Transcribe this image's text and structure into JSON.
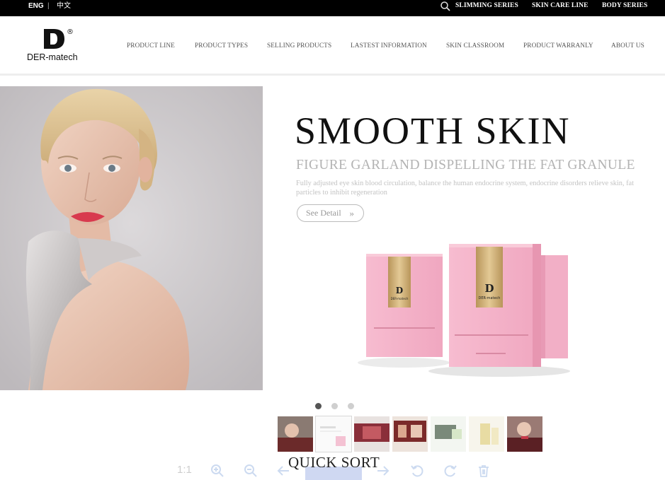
{
  "topbar": {
    "lang_eng": "ENG",
    "lang_separator": "|",
    "lang_cn": "中文",
    "search_icon": "search-icon",
    "series": [
      "SLIMMING SERIES",
      "SKIN CARE LINE",
      "BODY SERIES"
    ]
  },
  "header": {
    "logo_letter": "D",
    "logo_reg": "®",
    "logo_text": "DER-matech",
    "nav": [
      "PRODUCT LINE",
      "PRODUCT TYPES",
      "SELLING PRODUCTS",
      "LASTEST INFORMATION",
      "SKIN CLASSROOM",
      "PRODUCT WARRANLY",
      "ABOUT US"
    ]
  },
  "banner": {
    "headline": "SMOOTH SKIN",
    "subhead": "FIGURE GARLAND DISPELLING THE FAT GRANULE",
    "description": "Fully adjusted eye skin blood circulation, balance the human endocrine system, endocrine disorders relieve skin, fat particles to inhibit regeneration",
    "detail_button": "See Detail",
    "detail_chevron": "»",
    "product_brand": "DER-matech"
  },
  "slider": {
    "dot_count": 3,
    "active_index": 0
  },
  "thumbnails": {
    "count": 7,
    "selected_index": 1
  },
  "viewer_toolbar": {
    "actual_size": "1:1",
    "icons": [
      "zoom-in-icon",
      "zoom-out-icon",
      "prev-arrow-icon",
      "next-arrow-icon",
      "rotate-left-icon",
      "rotate-right-icon",
      "trash-icon"
    ]
  },
  "quick_sort": "QUICK SORT",
  "colors": {
    "topbar": "#000000",
    "product_pink": "#f4b3c9",
    "product_gold": "#c9a96b",
    "text_muted": "#b3b3b3"
  }
}
